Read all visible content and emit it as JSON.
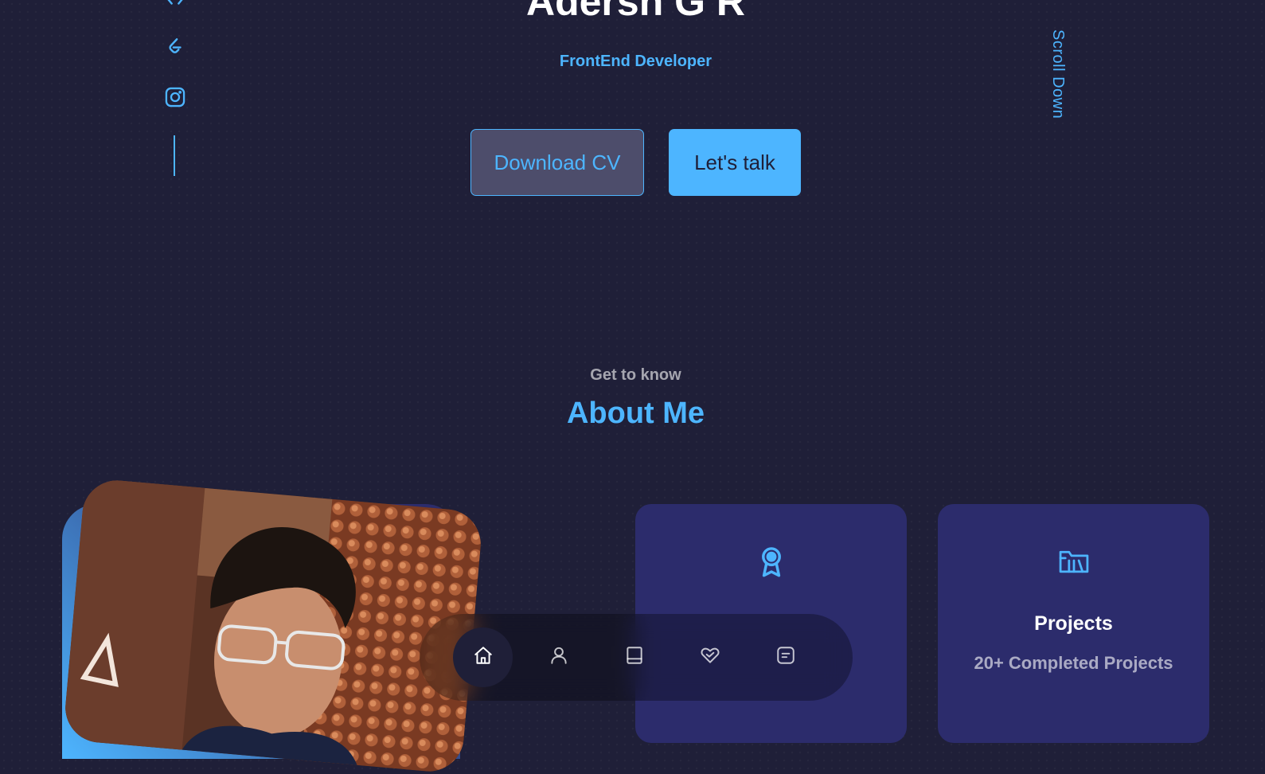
{
  "hero": {
    "name": "Adersh G R",
    "role": "FrontEnd Developer",
    "buttons": {
      "download_cv": "Download CV",
      "lets_talk": "Let's talk"
    },
    "scroll_down": "Scroll Down"
  },
  "socials": [
    {
      "icon": "code-icon"
    },
    {
      "icon": "leetcode-icon"
    },
    {
      "icon": "instagram-icon"
    }
  ],
  "about": {
    "subtitle": "Get to know",
    "title": "About Me",
    "cards": [
      {
        "icon": "award-icon",
        "title": "",
        "text": ""
      },
      {
        "icon": "projects-folder-icon",
        "title": "Projects",
        "text": "20+ Completed Projects"
      }
    ]
  },
  "nav": {
    "items": [
      {
        "icon": "home-icon",
        "active": true
      },
      {
        "icon": "user-icon",
        "active": false
      },
      {
        "icon": "book-icon",
        "active": false
      },
      {
        "icon": "heart-handshake-icon",
        "active": false
      },
      {
        "icon": "message-icon",
        "active": false
      }
    ]
  },
  "colors": {
    "background": "#1f1f38",
    "primary": "#4db5ff",
    "card": "#2c2c6c",
    "text": "#ffffff",
    "text_muted": "rgba(255,255,255,0.6)"
  }
}
